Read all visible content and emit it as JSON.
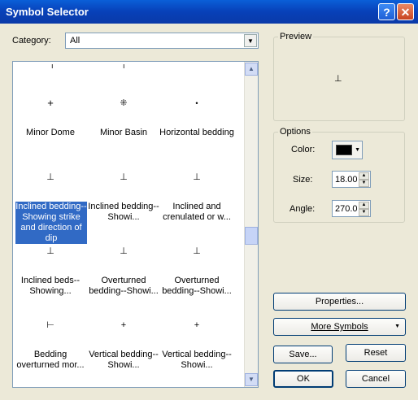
{
  "window": {
    "title": "Symbol Selector",
    "help_glyph": "?",
    "close_glyph": "✕"
  },
  "category": {
    "label": "Category:",
    "value": "All",
    "arrow": "▼"
  },
  "scroll": {
    "up": "▲",
    "down": "▼"
  },
  "symbols": [
    {
      "glyph": "+",
      "caption": "Minor Dome"
    },
    {
      "glyph": "⁜",
      "caption": "Minor Basin"
    },
    {
      "glyph": "•",
      "caption": "Horizontal bedding"
    },
    {
      "glyph": "⊥",
      "caption": "Inclined bedding--Showing strike and direction of dip"
    },
    {
      "glyph": "⊥",
      "caption": "Inclined bedding--Showi..."
    },
    {
      "glyph": "⊥",
      "caption": "Inclined and crenulated or w..."
    },
    {
      "glyph": "⊥",
      "caption": "Inclined beds--Showing..."
    },
    {
      "glyph": "⊥",
      "caption": "Overturned bedding--Showi..."
    },
    {
      "glyph": "⊥",
      "caption": "Overturned bedding--Showi..."
    },
    {
      "glyph": "⊢",
      "caption": "Bedding overturned mor..."
    },
    {
      "glyph": "+",
      "caption": "Vertical bedding--Showi..."
    },
    {
      "glyph": "+",
      "caption": "Vertical bedding--Showi..."
    }
  ],
  "preview": {
    "label": "Preview",
    "glyph": "⊥"
  },
  "options": {
    "label": "Options",
    "color_label": "Color:",
    "color_value": "#000000",
    "color_arrow": "▼",
    "size_label": "Size:",
    "size_value": "18.00",
    "angle_label": "Angle:",
    "angle_value": "270.0",
    "spin_up": "▲",
    "spin_down": "▼"
  },
  "buttons": {
    "properties": "Properties...",
    "more_symbols": "More Symbols",
    "more_arrow": "▼",
    "save": "Save...",
    "reset": "Reset",
    "ok": "OK",
    "cancel": "Cancel"
  }
}
